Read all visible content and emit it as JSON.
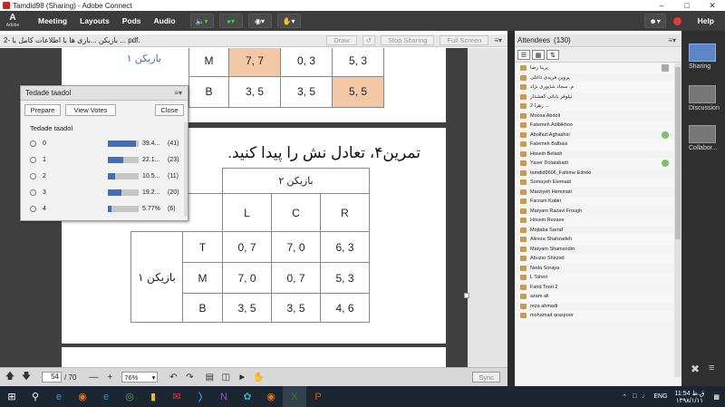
{
  "window": {
    "title": "Tamdid98 (Sharing) - Adobe Connect"
  },
  "menubar": {
    "logo_label": "Adobe",
    "items": [
      "Meeting",
      "Layouts",
      "Pods",
      "Audio"
    ],
    "help": "Help"
  },
  "doc": {
    "filename": "2- بازیکن ...بازی ها با اطلاعات کامل با ... pdf.",
    "buttons": {
      "draw": "Draw",
      "stop_sharing": "Stop Sharing",
      "full_screen": "Full Screen"
    },
    "top_table": {
      "player_label": "بازیکن ۱",
      "rows": [
        {
          "label": "M",
          "cells": [
            "7, 7",
            "0, 3",
            "5, 3"
          ]
        },
        {
          "label": "B",
          "cells": [
            "3, 5",
            "3, 5",
            "5, 5"
          ]
        }
      ]
    },
    "exercise_title": "تمرین۴، تعادل نش را پیدا کنید.",
    "table": {
      "player2": "بازیکن ۲",
      "player1": "بازیکن ۱",
      "columns": [
        "L",
        "C",
        "R"
      ],
      "rows": [
        {
          "label": "T",
          "cells": [
            "0, 7",
            "7, 0",
            "6, 3"
          ]
        },
        {
          "label": "M",
          "cells": [
            "7, 0",
            "0, 7",
            "5, 3"
          ]
        },
        {
          "label": "B",
          "cells": [
            "3, 5",
            "3, 5",
            "4, 6"
          ]
        }
      ]
    },
    "page_current": "54",
    "page_total": "/ 70",
    "zoom": "76%",
    "sync": "Sync"
  },
  "poll": {
    "title": "Tedade taadol",
    "prepare": "Prepare",
    "view_votes": "View Votes",
    "close": "Close",
    "question": "Tedade taadol",
    "options": [
      {
        "label": "0",
        "pct": "39.4...",
        "count": "(41)",
        "fraction": 0.394
      },
      {
        "label": "1",
        "pct": "22.1...",
        "count": "(23)",
        "fraction": 0.221
      },
      {
        "label": "2",
        "pct": "10.5...",
        "count": "(11)",
        "fraction": 0.105
      },
      {
        "label": "3",
        "pct": "19.2...",
        "count": "(20)",
        "fraction": 0.192
      },
      {
        "label": "4",
        "pct": "5.77%",
        "count": "(6)",
        "fraction": 0.0577
      }
    ]
  },
  "attendees": {
    "title": "Attendees",
    "count": "(130)",
    "list": [
      {
        "name": "پرینا رضا",
        "status": "hand"
      },
      {
        "name": "پروین فریدی داغلی",
        "status": ""
      },
      {
        "name": "م. سجاد شاپوری نژاد",
        "status": ""
      },
      {
        "name": "نیلوفر بابائی کفشدار",
        "status": ""
      },
      {
        "name": "2 زهرا ...",
        "status": ""
      },
      {
        "name": "Moosa Abdoli",
        "status": ""
      },
      {
        "name": "Fatemeh Adibikhoo",
        "status": ""
      },
      {
        "name": "Abolfazl Aghashiri",
        "status": "ok"
      },
      {
        "name": "Fatemeh Balbasi",
        "status": ""
      },
      {
        "name": "Hosein Belash",
        "status": ""
      },
      {
        "name": "Yaser Dolatabadi",
        "status": "ok"
      },
      {
        "name": "tamdid9606_Fahime Edreki",
        "status": ""
      },
      {
        "name": "Somayeh Etemadi",
        "status": ""
      },
      {
        "name": "Marziyeh Hemmati",
        "status": ""
      },
      {
        "name": "Farzam Kabiri",
        "status": ""
      },
      {
        "name": "Maryam Razavi Frough",
        "status": ""
      },
      {
        "name": "Hosein Rezaee",
        "status": ""
      },
      {
        "name": "Mojtaba Sarraf",
        "status": ""
      },
      {
        "name": "Alireza Shahzadeh",
        "status": ""
      },
      {
        "name": "Maryam Shamsodin",
        "status": ""
      },
      {
        "name": "Abuzar Shirzad",
        "status": ""
      },
      {
        "name": "Neda Soraya",
        "status": ""
      },
      {
        "name": "L Taheri",
        "status": ""
      },
      {
        "name": "Farid Toori 2",
        "status": ""
      },
      {
        "name": "azam ali",
        "status": ""
      },
      {
        "name": "reza ahmadi",
        "status": ""
      },
      {
        "name": "mohamad arazpoor",
        "status": ""
      }
    ]
  },
  "layouts": [
    {
      "label": "Sharing"
    },
    {
      "label": "Discussion"
    },
    {
      "label": "Collabor..."
    }
  ],
  "taskbar": {
    "lang": "ENG",
    "time": "11:54 ق.ظ",
    "date": "۱۳۹۸/۱/۱۱"
  },
  "colors": {
    "accent": "#3d6fbe",
    "highlight_cell": "#f4c7a6",
    "green_box": "#5cb85c"
  }
}
